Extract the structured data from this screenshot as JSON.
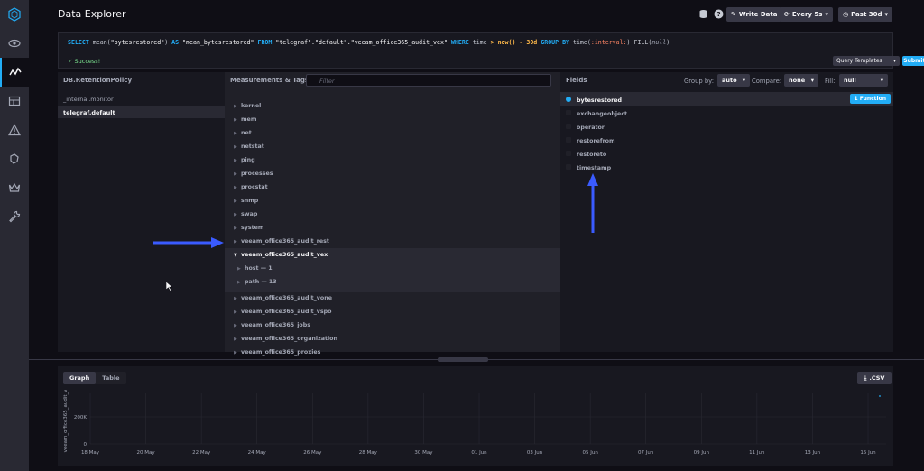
{
  "header": {
    "title": "Data Explorer",
    "write_data": "Write Data",
    "refresh": "Every 5s",
    "time_range": "Past 30d"
  },
  "query": {
    "parts": [
      {
        "text": "SELECT",
        "cls": "kw"
      },
      {
        "text": " mean(",
        "cls": ""
      },
      {
        "text": "\"bytesrestored\"",
        "cls": "str"
      },
      {
        "text": ") ",
        "cls": ""
      },
      {
        "text": "AS",
        "cls": "kw"
      },
      {
        "text": " ",
        "cls": ""
      },
      {
        "text": "\"mean_bytesrestored\"",
        "cls": "str"
      },
      {
        "text": " ",
        "cls": ""
      },
      {
        "text": "FROM",
        "cls": "kw"
      },
      {
        "text": " ",
        "cls": ""
      },
      {
        "text": "\"telegraf\".\"default\".\"veeam_office365_audit_vex\"",
        "cls": "str"
      },
      {
        "text": " ",
        "cls": ""
      },
      {
        "text": "WHERE",
        "cls": "kw"
      },
      {
        "text": " time ",
        "cls": ""
      },
      {
        "text": ">",
        "cls": "op"
      },
      {
        "text": " ",
        "cls": ""
      },
      {
        "text": "now()",
        "cls": "op"
      },
      {
        "text": " ",
        "cls": ""
      },
      {
        "text": "- 30d",
        "cls": "op"
      },
      {
        "text": " ",
        "cls": ""
      },
      {
        "text": "GROUP BY",
        "cls": "kw"
      },
      {
        "text": " time(",
        "cls": ""
      },
      {
        "text": ":interval:",
        "cls": "var"
      },
      {
        "text": ") FILL(",
        "cls": ""
      },
      {
        "text": "null",
        "cls": "null"
      },
      {
        "text": ")",
        "cls": ""
      }
    ],
    "status": "✓ Success!",
    "templates_label": "Query Templates",
    "submit_label": "Submit Query"
  },
  "db_column": {
    "header": "DB.RetentionPolicy",
    "items": [
      {
        "label": "_internal.monitor",
        "active": false
      },
      {
        "label": "telegraf.default",
        "active": true
      }
    ]
  },
  "measurements": {
    "header": "Measurements & Tags",
    "filter_placeholder": "Filter",
    "items": [
      {
        "label": "kernel"
      },
      {
        "label": "mem"
      },
      {
        "label": "net"
      },
      {
        "label": "netstat"
      },
      {
        "label": "ping"
      },
      {
        "label": "processes"
      },
      {
        "label": "procstat"
      },
      {
        "label": "snmp"
      },
      {
        "label": "swap"
      },
      {
        "label": "system"
      },
      {
        "label": "veeam_office365_audit_rest"
      },
      {
        "label": "veeam_office365_audit_vex",
        "open": true,
        "tags": [
          "host — 1",
          "path — 13"
        ]
      },
      {
        "label": "veeam_office365_audit_vone"
      },
      {
        "label": "veeam_office365_audit_vspo"
      },
      {
        "label": "veeam_office365_jobs"
      },
      {
        "label": "veeam_office365_organization"
      },
      {
        "label": "veeam_office365_proxies"
      }
    ]
  },
  "fields": {
    "header": "Fields",
    "group_by_label": "Group by:",
    "group_by_value": "auto",
    "compare_label": "Compare:",
    "compare_value": "none",
    "fill_label": "Fill:",
    "fill_value": "null",
    "function_badge": "1 Function",
    "items": [
      {
        "label": "bytesrestored",
        "active": true
      },
      {
        "label": "exchangeobject",
        "active": false
      },
      {
        "label": "operator",
        "active": false
      },
      {
        "label": "restorefrom",
        "active": false
      },
      {
        "label": "restoreto",
        "active": false
      },
      {
        "label": "timestamp",
        "active": false
      }
    ]
  },
  "graph": {
    "tab_graph": "Graph",
    "tab_table": "Table",
    "csv_label": ".CSV"
  },
  "chart_data": {
    "type": "line",
    "ylabel": "veeam_office365_audit_v...",
    "y_ticks": [
      "0",
      "200K"
    ],
    "x_ticks": [
      "18 May",
      "20 May",
      "22 May",
      "24 May",
      "26 May",
      "28 May",
      "30 May",
      "01 Jun",
      "03 Jun",
      "05 Jun",
      "07 Jun",
      "09 Jun",
      "11 Jun",
      "13 Jun",
      "15 Jun"
    ],
    "grid": true,
    "accent": "#22adf6"
  },
  "colors": {
    "accent": "#22adf6",
    "success": "#7ce490",
    "annotation_arrow": "#3a5bff"
  }
}
